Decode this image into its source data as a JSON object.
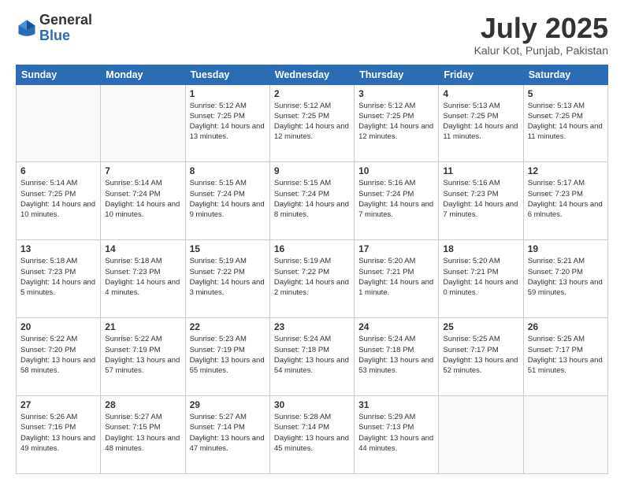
{
  "header": {
    "logo_general": "General",
    "logo_blue": "Blue",
    "month": "July 2025",
    "location": "Kalur Kot, Punjab, Pakistan"
  },
  "days_of_week": [
    "Sunday",
    "Monday",
    "Tuesday",
    "Wednesday",
    "Thursday",
    "Friday",
    "Saturday"
  ],
  "weeks": [
    [
      {
        "day": null
      },
      {
        "day": null
      },
      {
        "day": "1",
        "sunrise": "Sunrise: 5:12 AM",
        "sunset": "Sunset: 7:25 PM",
        "daylight": "Daylight: 14 hours and 13 minutes."
      },
      {
        "day": "2",
        "sunrise": "Sunrise: 5:12 AM",
        "sunset": "Sunset: 7:25 PM",
        "daylight": "Daylight: 14 hours and 12 minutes."
      },
      {
        "day": "3",
        "sunrise": "Sunrise: 5:12 AM",
        "sunset": "Sunset: 7:25 PM",
        "daylight": "Daylight: 14 hours and 12 minutes."
      },
      {
        "day": "4",
        "sunrise": "Sunrise: 5:13 AM",
        "sunset": "Sunset: 7:25 PM",
        "daylight": "Daylight: 14 hours and 11 minutes."
      },
      {
        "day": "5",
        "sunrise": "Sunrise: 5:13 AM",
        "sunset": "Sunset: 7:25 PM",
        "daylight": "Daylight: 14 hours and 11 minutes."
      }
    ],
    [
      {
        "day": "6",
        "sunrise": "Sunrise: 5:14 AM",
        "sunset": "Sunset: 7:25 PM",
        "daylight": "Daylight: 14 hours and 10 minutes."
      },
      {
        "day": "7",
        "sunrise": "Sunrise: 5:14 AM",
        "sunset": "Sunset: 7:24 PM",
        "daylight": "Daylight: 14 hours and 10 minutes."
      },
      {
        "day": "8",
        "sunrise": "Sunrise: 5:15 AM",
        "sunset": "Sunset: 7:24 PM",
        "daylight": "Daylight: 14 hours and 9 minutes."
      },
      {
        "day": "9",
        "sunrise": "Sunrise: 5:15 AM",
        "sunset": "Sunset: 7:24 PM",
        "daylight": "Daylight: 14 hours and 8 minutes."
      },
      {
        "day": "10",
        "sunrise": "Sunrise: 5:16 AM",
        "sunset": "Sunset: 7:24 PM",
        "daylight": "Daylight: 14 hours and 7 minutes."
      },
      {
        "day": "11",
        "sunrise": "Sunrise: 5:16 AM",
        "sunset": "Sunset: 7:23 PM",
        "daylight": "Daylight: 14 hours and 7 minutes."
      },
      {
        "day": "12",
        "sunrise": "Sunrise: 5:17 AM",
        "sunset": "Sunset: 7:23 PM",
        "daylight": "Daylight: 14 hours and 6 minutes."
      }
    ],
    [
      {
        "day": "13",
        "sunrise": "Sunrise: 5:18 AM",
        "sunset": "Sunset: 7:23 PM",
        "daylight": "Daylight: 14 hours and 5 minutes."
      },
      {
        "day": "14",
        "sunrise": "Sunrise: 5:18 AM",
        "sunset": "Sunset: 7:23 PM",
        "daylight": "Daylight: 14 hours and 4 minutes."
      },
      {
        "day": "15",
        "sunrise": "Sunrise: 5:19 AM",
        "sunset": "Sunset: 7:22 PM",
        "daylight": "Daylight: 14 hours and 3 minutes."
      },
      {
        "day": "16",
        "sunrise": "Sunrise: 5:19 AM",
        "sunset": "Sunset: 7:22 PM",
        "daylight": "Daylight: 14 hours and 2 minutes."
      },
      {
        "day": "17",
        "sunrise": "Sunrise: 5:20 AM",
        "sunset": "Sunset: 7:21 PM",
        "daylight": "Daylight: 14 hours and 1 minute."
      },
      {
        "day": "18",
        "sunrise": "Sunrise: 5:20 AM",
        "sunset": "Sunset: 7:21 PM",
        "daylight": "Daylight: 14 hours and 0 minutes."
      },
      {
        "day": "19",
        "sunrise": "Sunrise: 5:21 AM",
        "sunset": "Sunset: 7:20 PM",
        "daylight": "Daylight: 13 hours and 59 minutes."
      }
    ],
    [
      {
        "day": "20",
        "sunrise": "Sunrise: 5:22 AM",
        "sunset": "Sunset: 7:20 PM",
        "daylight": "Daylight: 13 hours and 58 minutes."
      },
      {
        "day": "21",
        "sunrise": "Sunrise: 5:22 AM",
        "sunset": "Sunset: 7:19 PM",
        "daylight": "Daylight: 13 hours and 57 minutes."
      },
      {
        "day": "22",
        "sunrise": "Sunrise: 5:23 AM",
        "sunset": "Sunset: 7:19 PM",
        "daylight": "Daylight: 13 hours and 55 minutes."
      },
      {
        "day": "23",
        "sunrise": "Sunrise: 5:24 AM",
        "sunset": "Sunset: 7:18 PM",
        "daylight": "Daylight: 13 hours and 54 minutes."
      },
      {
        "day": "24",
        "sunrise": "Sunrise: 5:24 AM",
        "sunset": "Sunset: 7:18 PM",
        "daylight": "Daylight: 13 hours and 53 minutes."
      },
      {
        "day": "25",
        "sunrise": "Sunrise: 5:25 AM",
        "sunset": "Sunset: 7:17 PM",
        "daylight": "Daylight: 13 hours and 52 minutes."
      },
      {
        "day": "26",
        "sunrise": "Sunrise: 5:25 AM",
        "sunset": "Sunset: 7:17 PM",
        "daylight": "Daylight: 13 hours and 51 minutes."
      }
    ],
    [
      {
        "day": "27",
        "sunrise": "Sunrise: 5:26 AM",
        "sunset": "Sunset: 7:16 PM",
        "daylight": "Daylight: 13 hours and 49 minutes."
      },
      {
        "day": "28",
        "sunrise": "Sunrise: 5:27 AM",
        "sunset": "Sunset: 7:15 PM",
        "daylight": "Daylight: 13 hours and 48 minutes."
      },
      {
        "day": "29",
        "sunrise": "Sunrise: 5:27 AM",
        "sunset": "Sunset: 7:14 PM",
        "daylight": "Daylight: 13 hours and 47 minutes."
      },
      {
        "day": "30",
        "sunrise": "Sunrise: 5:28 AM",
        "sunset": "Sunset: 7:14 PM",
        "daylight": "Daylight: 13 hours and 45 minutes."
      },
      {
        "day": "31",
        "sunrise": "Sunrise: 5:29 AM",
        "sunset": "Sunset: 7:13 PM",
        "daylight": "Daylight: 13 hours and 44 minutes."
      },
      {
        "day": null
      },
      {
        "day": null
      }
    ]
  ]
}
